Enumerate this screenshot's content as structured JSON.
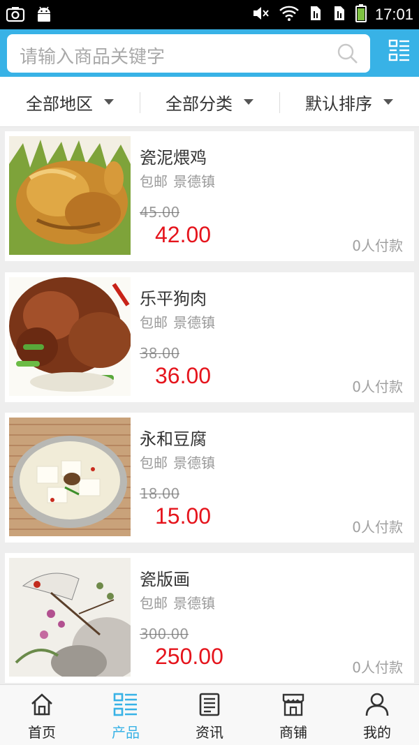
{
  "status_bar": {
    "time": "17:01"
  },
  "search": {
    "placeholder": "请输入商品关键字"
  },
  "filters": [
    {
      "label": "全部地区"
    },
    {
      "label": "全部分类"
    },
    {
      "label": "默认排序"
    }
  ],
  "products": [
    {
      "name": "瓷泥煨鸡",
      "shipping": "包邮",
      "location": "景德镇",
      "old_price": "45.00",
      "price": "42.00",
      "paid": "0人付款"
    },
    {
      "name": "乐平狗肉",
      "shipping": "包邮",
      "location": "景德镇",
      "old_price": "38.00",
      "price": "36.00",
      "paid": "0人付款"
    },
    {
      "name": "永和豆腐",
      "shipping": "包邮",
      "location": "景德镇",
      "old_price": "18.00",
      "price": "15.00",
      "paid": "0人付款"
    },
    {
      "name": "瓷版画",
      "shipping": "包邮",
      "location": "景德镇",
      "old_price": "300.00",
      "price": "250.00",
      "paid": "0人付款"
    }
  ],
  "bottom_nav": [
    {
      "label": "首页",
      "icon": "home-icon"
    },
    {
      "label": "产品",
      "icon": "product-grid-icon",
      "active": true
    },
    {
      "label": "资讯",
      "icon": "news-icon"
    },
    {
      "label": "商铺",
      "icon": "shop-icon"
    },
    {
      "label": "我的",
      "icon": "profile-icon"
    }
  ],
  "colors": {
    "accent": "#38b2e6",
    "price": "#e5141c"
  }
}
